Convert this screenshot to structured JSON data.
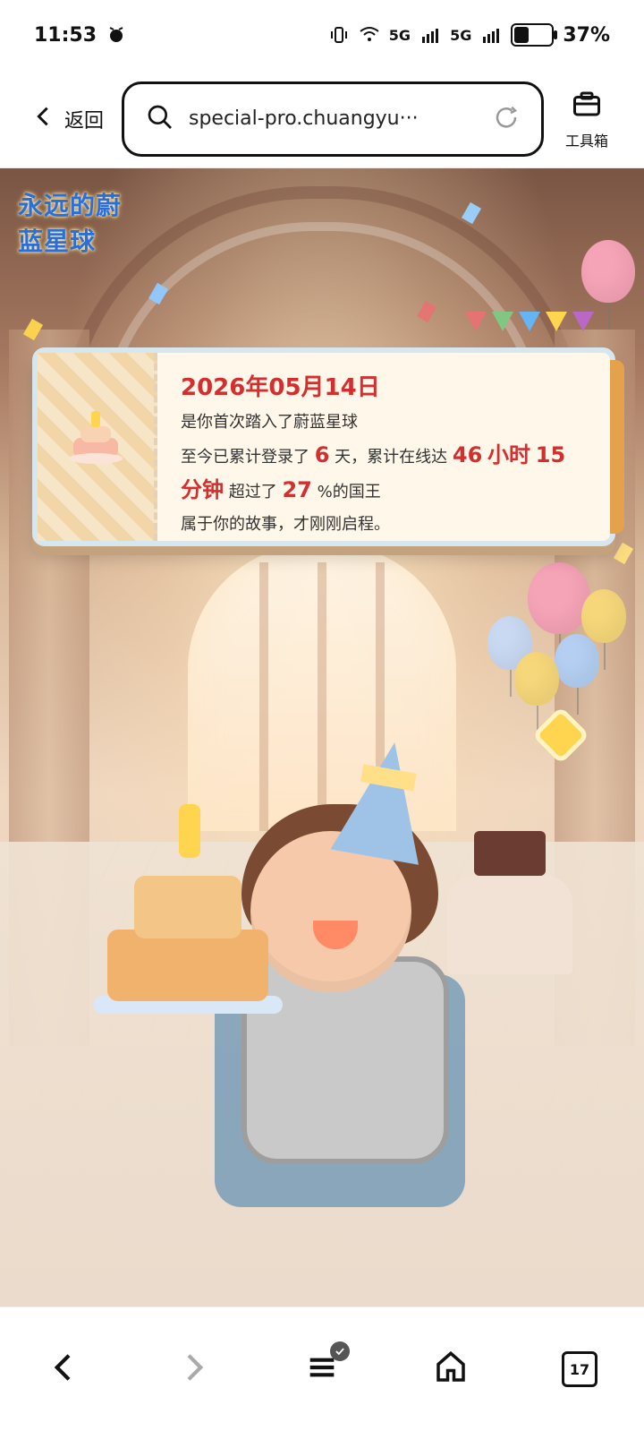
{
  "status_bar": {
    "time": "11:53",
    "battery_percent": "37%",
    "network_label_1": "5G",
    "network_label_2": "5G"
  },
  "toolbar": {
    "back_label": "返回",
    "address_text": "special-pro.chuangyu···",
    "toolbox_label": "工具箱"
  },
  "content": {
    "logo_text": "永远的蔚蓝星球",
    "card": {
      "date": "2026年05月14日",
      "line1": "是你首次踏入了蔚蓝星球",
      "line2_prefix": "至今已累计登录了",
      "days": "6",
      "line2_mid": "天，累计在线达",
      "hours": "46",
      "hours_unit": "小时",
      "minutes": "15",
      "minutes_unit": "分钟",
      "line3_mid": " 超过了",
      "percent": "27",
      "line3_suffix": "%的国王",
      "line4": "属于你的故事，才刚刚启程。"
    }
  },
  "bottom_nav": {
    "tab_count": "17"
  },
  "colors": {
    "accent_red": "#d32f2f",
    "toolbar_border": "#111111"
  }
}
